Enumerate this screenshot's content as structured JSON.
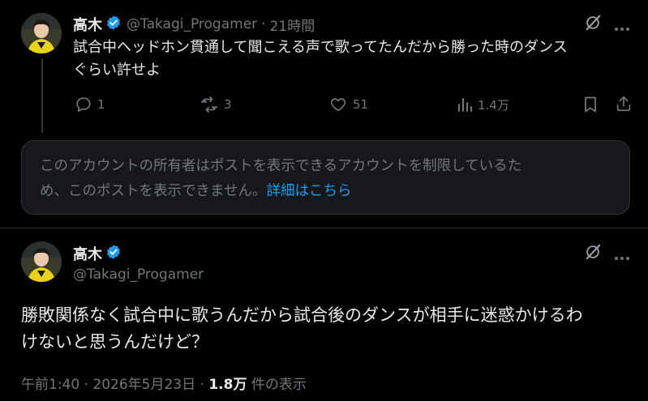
{
  "reply": {
    "name": "高木",
    "handle": "@Takagi_Progamer",
    "separator": "·",
    "time": "21時間",
    "text_line1": "試合中ヘッドホン貫通して聞こえる声で歌ってたんだから勝った時のダンス",
    "text_line2": "ぐらい許せよ",
    "actions": {
      "replies": "1",
      "reposts": "3",
      "likes": "51",
      "views": "1.4万"
    },
    "icons": [
      "grok-icon",
      "more-icon",
      "reply-icon",
      "repost-icon",
      "like-icon",
      "views-icon",
      "bookmark-icon",
      "share-icon"
    ]
  },
  "notice": {
    "text_line1": "このアカウントの所有者はポストを表示できるアカウントを制限しているた",
    "text_line2": "め、このポストを表示できません。",
    "link": "詳細はこちら"
  },
  "main": {
    "name": "高木",
    "handle": "@Takagi_Progamer",
    "text_line1": "勝敗関係なく試合中に歌うんだから試合後のダンスが相手に迷惑かけるわ",
    "text_line2": "けないと思うんだけど？",
    "time": "午前1:40",
    "dot": "·",
    "date": "2026年5月23日",
    "views_count": "1.8万",
    "views_label": "件の表示"
  },
  "colors": {
    "background": "#000000",
    "text": "#e7e9ea",
    "muted": "#71767b",
    "link": "#1d9bf0",
    "verified": "#1d9bf0",
    "notice_bg": "#16181c"
  }
}
